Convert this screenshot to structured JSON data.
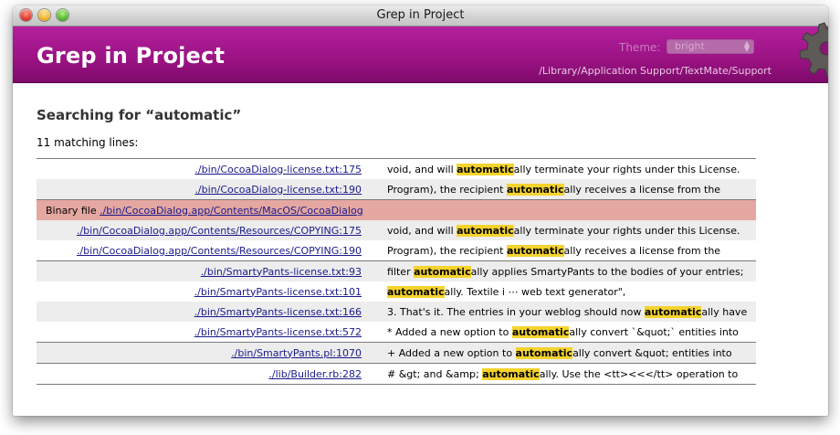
{
  "window": {
    "title": "Grep in Project"
  },
  "header": {
    "app_title": "Grep in Project",
    "theme_label": "Theme:",
    "theme_value": "bright",
    "support_path": "/Library/Application Support/TextMate/Support"
  },
  "search": {
    "heading": "Searching for “automatic”",
    "count_text": "11 matching lines:",
    "term": "automatic"
  },
  "binary_row": {
    "prefix": "Binary file",
    "link": "./bin/CocoaDialog.app/Contents/MacOS/CocoaDialog"
  },
  "results": [
    {
      "file": "./bin/CocoaDialog-license.txt:175",
      "before": "void, and will ",
      "match": "automatic",
      "after": "ally terminate your rights under this License."
    },
    {
      "file": "./bin/CocoaDialog-license.txt:190",
      "before": "Program), the recipient ",
      "match": "automatic",
      "after": "ally receives a license from the"
    },
    {
      "file": "./bin/CocoaDialog.app/Contents/Resources/COPYING:175",
      "before": "void, and will ",
      "match": "automatic",
      "after": "ally terminate your rights under this License."
    },
    {
      "file": "./bin/CocoaDialog.app/Contents/Resources/COPYING:190",
      "before": "Program), the recipient ",
      "match": "automatic",
      "after": "ally receives a license from the"
    },
    {
      "file": "./bin/SmartyPants-license.txt:93",
      "before": "filter ",
      "match": "automatic",
      "after": "ally applies SmartyPants to the bodies of your entries;"
    },
    {
      "file": "./bin/SmartyPants-license.txt:101",
      "before": "",
      "match": "automatic",
      "after": "ally. Textile i ⋯ web text generator\","
    },
    {
      "file": "./bin/SmartyPants-license.txt:166",
      "before": "3. That's it. The entries in your weblog should now ",
      "match": "automatic",
      "after": "ally have"
    },
    {
      "file": "./bin/SmartyPants-license.txt:572",
      "before": "* Added a new option to ",
      "match": "automatic",
      "after": "ally convert `&quot;` entities into"
    },
    {
      "file": "./bin/SmartyPants.pl:1070",
      "before": "+ Added a new option to ",
      "match": "automatic",
      "after": "ally convert &quot; entities into"
    },
    {
      "file": "./lib/Builder.rb:282",
      "before": "# &gt; and &amp; ",
      "match": "automatic",
      "after": "ally. Use the <tt><<</tt> operation to"
    }
  ],
  "colors": {
    "header_bg": "#9a1283",
    "highlight": "#f5d32e",
    "binary_row_bg": "#e5a7a1",
    "link": "#1a1a8c"
  }
}
